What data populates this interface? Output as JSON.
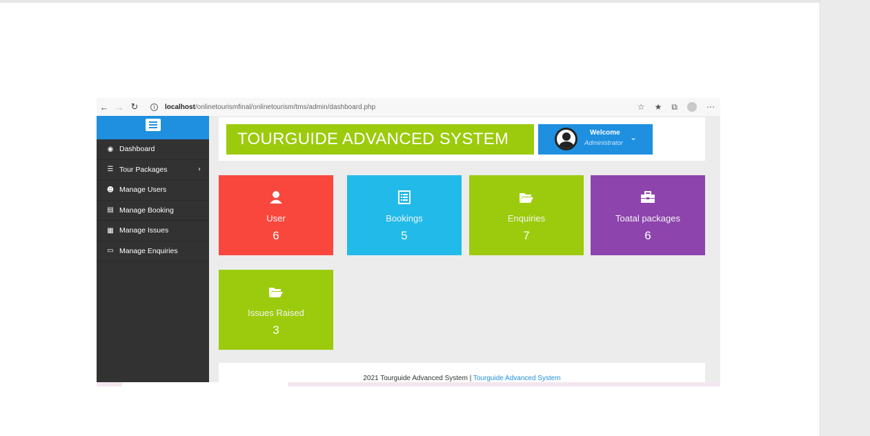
{
  "browser": {
    "url_host": "localhost",
    "url_path": "/onlinetourismfinal/onlinetourism/tms/admin/dashboard.php",
    "icons": [
      "back-arrow-icon",
      "forward-arrow-icon",
      "refresh-icon",
      "info-icon",
      "read-aloud-icon",
      "favorites-icon",
      "collections-icon",
      "profile-icon",
      "more-icon"
    ]
  },
  "sidebar": {
    "items": [
      {
        "label": "Dashboard",
        "icon": "dashboard-icon"
      },
      {
        "label": "Tour Packages",
        "icon": "list-icon",
        "has_submenu": true
      },
      {
        "label": "Manage Users",
        "icon": "users-icon"
      },
      {
        "label": "Manage Booking",
        "icon": "list-alt-icon"
      },
      {
        "label": "Manage Issues",
        "icon": "table-icon"
      },
      {
        "label": "Manage Enquiries",
        "icon": "file-icon"
      }
    ]
  },
  "header": {
    "title": "TOURGUIDE ADVANCED SYSTEM",
    "welcome": "Welcome",
    "role": "Administrator"
  },
  "tiles": [
    {
      "label": "User",
      "value": "6",
      "icon": "user-icon",
      "color": "#f9473e"
    },
    {
      "label": "Bookings",
      "value": "5",
      "icon": "list-box-icon",
      "color": "#22bbe9"
    },
    {
      "label": "Enquiries",
      "value": "7",
      "icon": "folder-open-icon",
      "color": "#9bcb0c"
    },
    {
      "label": "Toatal packages",
      "value": "6",
      "icon": "briefcase-icon",
      "color": "#8e44ad"
    },
    {
      "label": "Issues Raised",
      "value": "3",
      "icon": "folder-open-icon",
      "color": "#9bcb0c"
    }
  ],
  "footer": {
    "text": "2021 Tourguide Advanced System | ",
    "link": "Tourguide Advanced System"
  },
  "colors": {
    "sidebar_bg": "#323232",
    "accent_blue": "#1e90df",
    "accent_green": "#9bcb0c"
  }
}
